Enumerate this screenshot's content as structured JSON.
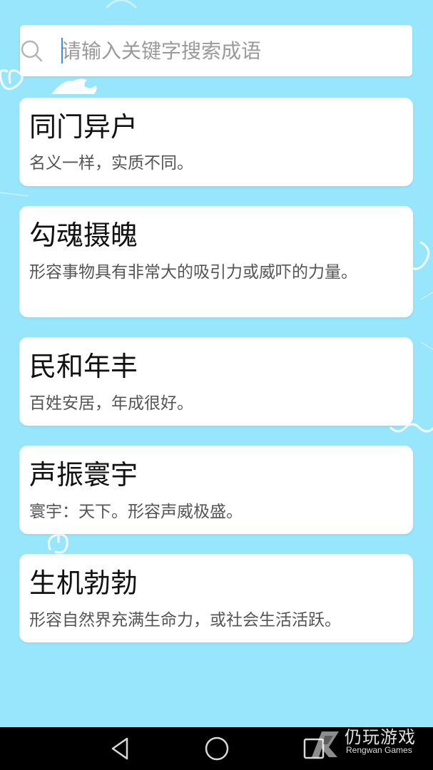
{
  "search": {
    "placeholder": "请输入关键字搜索成语",
    "value": ""
  },
  "idioms": [
    {
      "title": "同门异户",
      "desc": "名义一样，实质不同。"
    },
    {
      "title": "勾魂摄魄",
      "desc": "形容事物具有非常大的吸引力或威吓的力量。"
    },
    {
      "title": "民和年丰",
      "desc": "百姓安居，年成很好。"
    },
    {
      "title": "声振寰宇",
      "desc": "寰宇：天下。形容声威极盛。"
    },
    {
      "title": "生机勃勃",
      "desc": "形容自然界充满生命力，或社会生活活跃。"
    }
  ],
  "navbar": {
    "back_icon": "back-triangle",
    "home_icon": "home-circle",
    "recents_icon": "recents-square"
  },
  "watermark": {
    "title": "仍玩游戏",
    "subtitle": "Rengwan Games"
  },
  "colors": {
    "background": "#97e6fb",
    "card": "#ffffff",
    "nav": "#000000"
  }
}
